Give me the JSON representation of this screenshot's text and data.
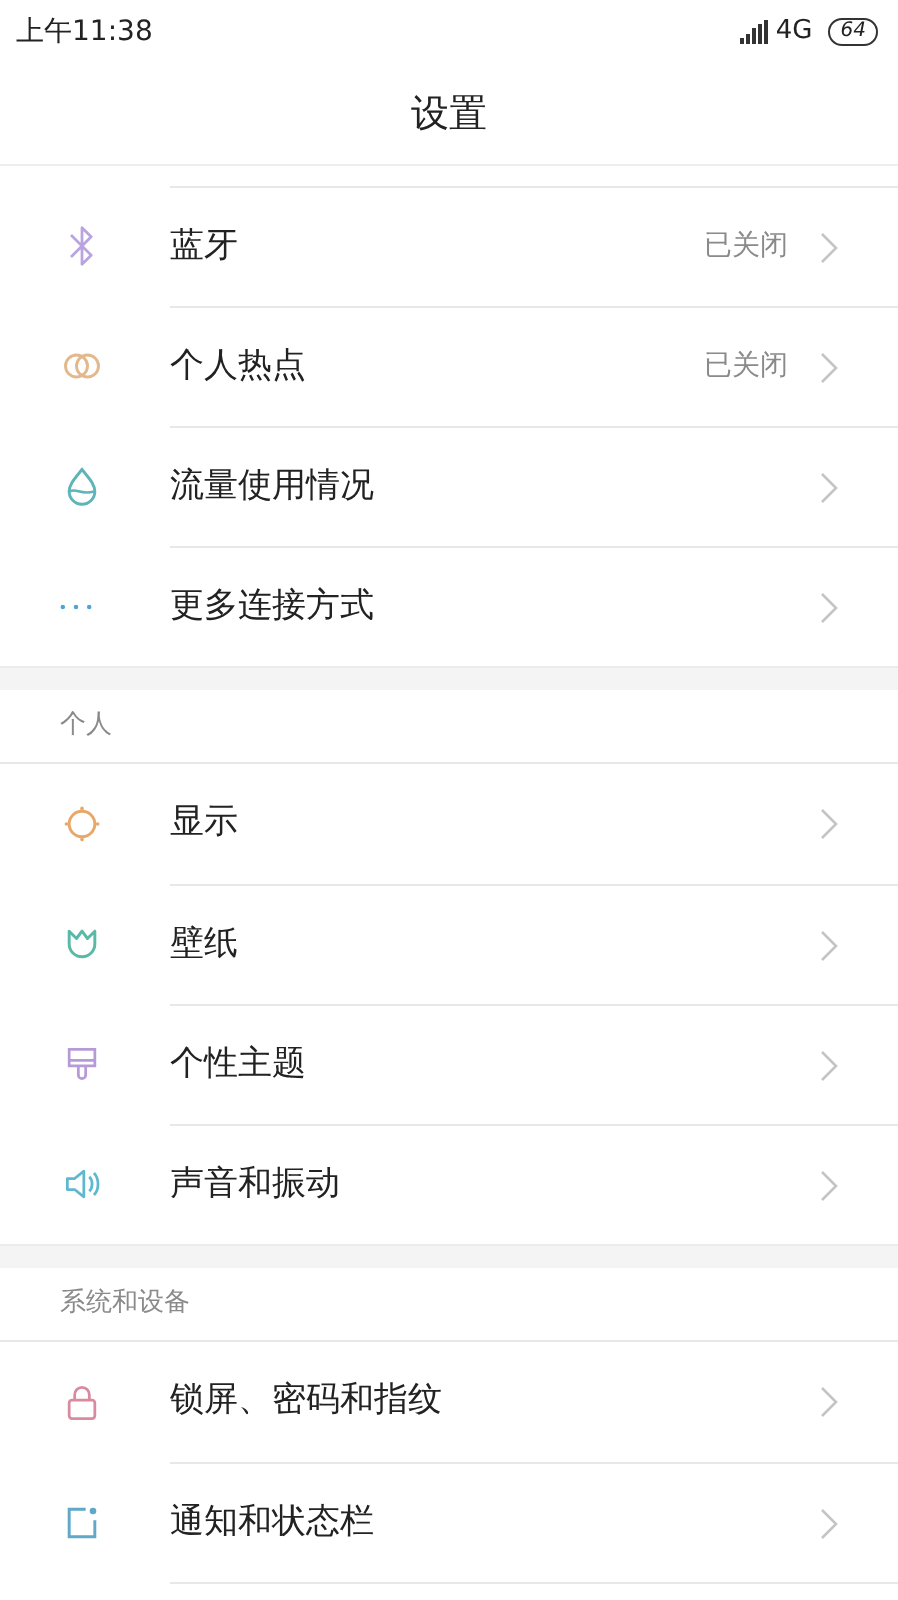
{
  "status_bar": {
    "time": "上午11:38",
    "network": "4G",
    "battery": "64"
  },
  "title": "设置",
  "sections": [
    {
      "items": [
        {
          "label": "蓝牙",
          "value": "已关闭"
        },
        {
          "label": "个人热点",
          "value": "已关闭"
        },
        {
          "label": "流量使用情况"
        },
        {
          "label": "更多连接方式"
        }
      ]
    },
    {
      "header": "个人",
      "items": [
        {
          "label": "显示"
        },
        {
          "label": "壁纸"
        },
        {
          "label": "个性主题"
        },
        {
          "label": "声音和振动"
        }
      ]
    },
    {
      "header": "系统和设备",
      "items": [
        {
          "label": "锁屏、密码和指纹"
        },
        {
          "label": "通知和状态栏"
        }
      ]
    }
  ]
}
